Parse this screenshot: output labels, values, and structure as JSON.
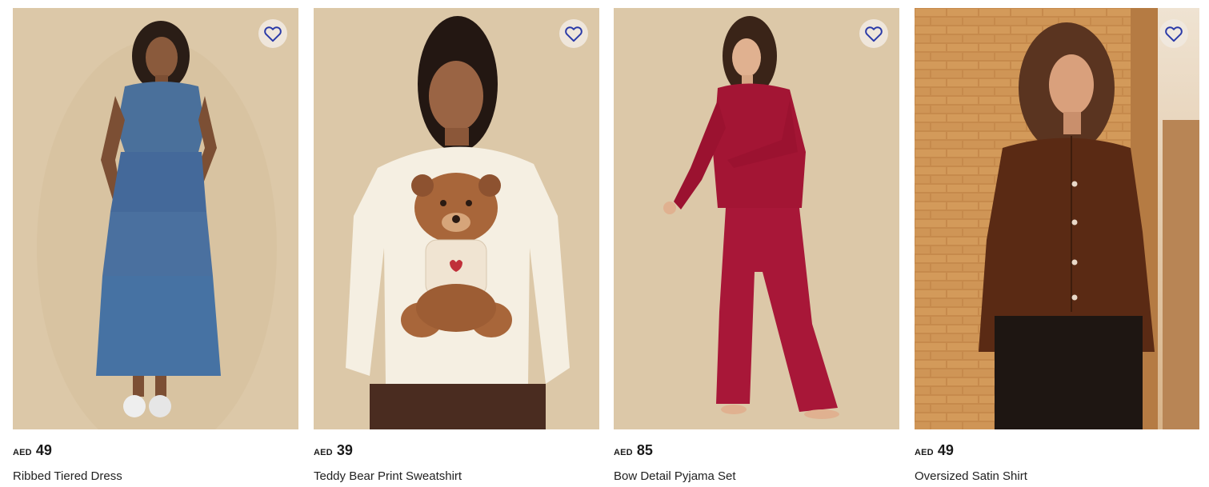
{
  "products": [
    {
      "currency": "AED",
      "price": "49",
      "title": "Ribbed Tiered Dress",
      "wishlist_icon": "heart-outline-icon",
      "image": "model in blue tiered midi dress",
      "bg_color": "#dcc8a8"
    },
    {
      "currency": "AED",
      "price": "39",
      "title": "Teddy Bear Print Sweatshirt",
      "wishlist_icon": "heart-outline-icon",
      "image": "model in cream teddy bear sweatshirt",
      "bg_color": "#dcc8a8"
    },
    {
      "currency": "AED",
      "price": "85",
      "title": "Bow Detail Pyjama Set",
      "wishlist_icon": "heart-outline-icon",
      "image": "model in burgundy satin pyjama set",
      "bg_color": "#dcc8a8"
    },
    {
      "currency": "AED",
      "price": "49",
      "title": "Oversized Satin Shirt",
      "wishlist_icon": "heart-outline-icon",
      "image": "model in brown satin shirt by brick wall",
      "bg_color": "#c8904f"
    }
  ],
  "colors": {
    "heart_stroke": "#2a3aa8",
    "text": "#1a1a1a"
  }
}
